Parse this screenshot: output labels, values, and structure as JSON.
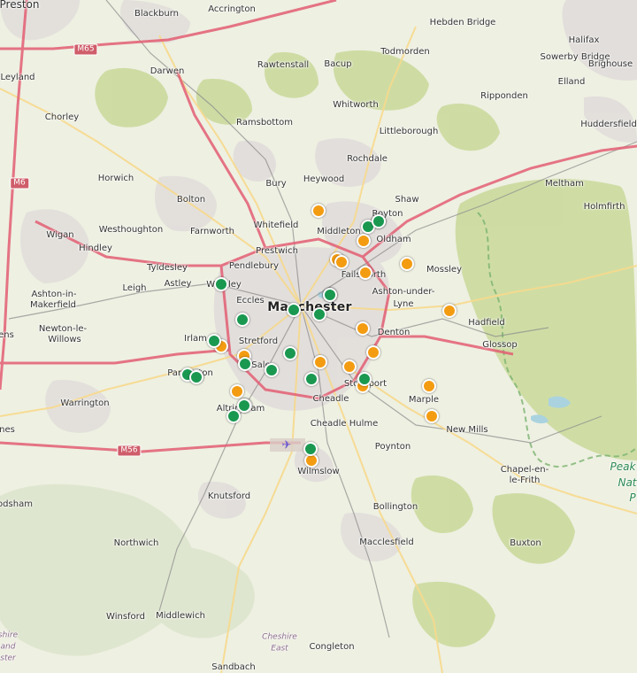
{
  "map": {
    "labels": {
      "preston": "Preston",
      "blackburn": "Blackburn",
      "accrington": "Accrington",
      "hebden_bridge": "Hebden Bridge",
      "halifax": "Halifax",
      "m65": "M65",
      "leyland": "Leyland",
      "darwen": "Darwen",
      "rawtenstall": "Rawtenstall",
      "bacup": "Bacup",
      "todmorden": "Todmorden",
      "sowerby_bridge": "Sowerby Bridge",
      "elland": "Elland",
      "brighouse": "Brighouse",
      "ripponden": "Ripponden",
      "whitworth": "Whitworth",
      "chorley": "Chorley",
      "ramsbottom": "Ramsbottom",
      "littleborough": "Littleborough",
      "huddersfield": "Huddersfield",
      "rochdale": "Rochdale",
      "m6": "M6",
      "horwich": "Horwich",
      "heywood": "Heywood",
      "bury": "Bury",
      "meltham": "Meltham",
      "bolton": "Bolton",
      "shaw": "Shaw",
      "royton": "Royton",
      "holmfirth": "Holmfirth",
      "wigan": "Wigan",
      "westhoughton": "Westhoughton",
      "farnworth": "Farnworth",
      "whitefield": "Whitefield",
      "middleton": "Middleton",
      "oldham": "Oldham",
      "hindley": "Hindley",
      "prestwich": "Prestwich",
      "tyldesley": "Tyldesley",
      "pendlebury": "Pendlebury",
      "mossley": "Mossley",
      "failsworth": "Failsworth",
      "astley": "Astley",
      "worsley": "Worsley",
      "leigh": "Leigh",
      "ashton_in_makerfield_1": "Ashton-in-",
      "ashton_in_makerfield_2": "Makerfield",
      "ashton_under_lyne_1": "Ashton-under-",
      "ashton_under_lyne_2": "Lyne",
      "eccles": "Eccles",
      "manchester": "Manchester",
      "hadfield": "Hadfield",
      "newton_1": "Newton-le-",
      "newton_2": "Willows",
      "denton": "Denton",
      "irlam": "Irlam",
      "stretford": "Stretford",
      "glossop": "Glossop",
      "ens": "ens",
      "sale": "Sale",
      "partington": "Partington",
      "stockport": "Stockport",
      "warrington": "Warrington",
      "cheadle": "Cheadle",
      "marple": "Marple",
      "altrincham": "Altrincham",
      "cheadle_hulme": "Cheadle Hulme",
      "new_mills": "New Mills",
      "nes": "nes",
      "m56": "M56",
      "poynton": "Poynton",
      "wilmslow": "Wilmslow",
      "peak_1": "Peak",
      "peak_2": "Nat",
      "peak_3": "P",
      "chapel_1": "Chapel-en-",
      "chapel_2": "le-Frith",
      "odsham": "odsham",
      "knutsford": "Knutsford",
      "bollington": "Bollington",
      "macclesfield": "Macclesfield",
      "northwich": "Northwich",
      "buxton": "Buxton",
      "winsford": "Winsford",
      "middlewich": "Middlewich",
      "cheshire_west_1": "shire",
      "cheshire_west_2": "and",
      "cheshire_west_3": "ster",
      "cheshire_east_1": "Cheshire",
      "cheshire_east_2": "East",
      "congleton": "Congleton",
      "sandbach": "Sandbach"
    },
    "marker_colors": {
      "green": "#1a9850",
      "orange": "#f39c12"
    },
    "markers": {
      "total": 40,
      "green_count": 20,
      "orange_count": 20
    }
  }
}
